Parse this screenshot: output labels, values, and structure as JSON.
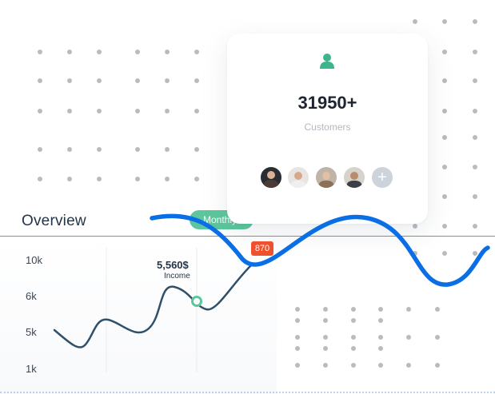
{
  "overview": {
    "title": "Overview",
    "period": "Monthly",
    "y_ticks": [
      "10k",
      "6k",
      "5k",
      "1k"
    ],
    "tooltip": {
      "value": "5,560$",
      "label": "Income"
    },
    "badge": "870"
  },
  "customers_card": {
    "icon": "user-icon",
    "value": "31950+",
    "label": "Customers",
    "avatars": [
      "avatar-1",
      "avatar-2",
      "avatar-3",
      "avatar-4"
    ],
    "add_icon": "plus-icon"
  },
  "colors": {
    "accent_green": "#5cc79c",
    "wave_blue": "#0a6fe6",
    "line_navy": "#30506a",
    "badge_red": "#f0512d",
    "divider_orange": "#ef6a45"
  }
}
